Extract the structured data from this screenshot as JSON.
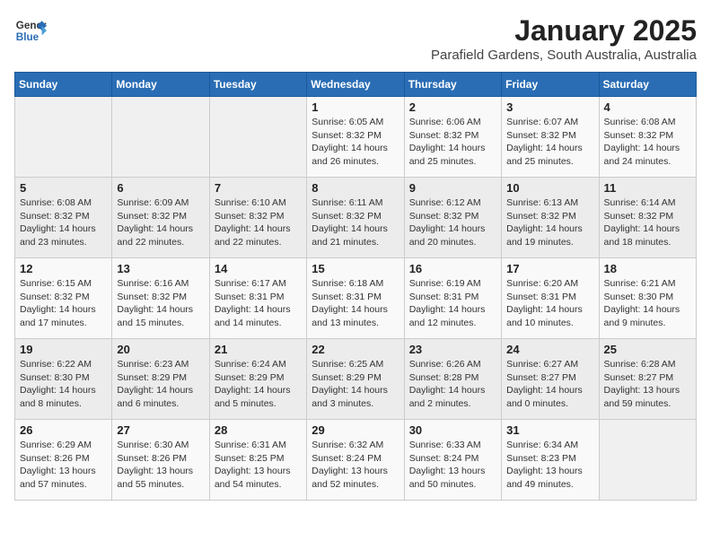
{
  "header": {
    "logo_general": "General",
    "logo_blue": "Blue",
    "month_title": "January 2025",
    "location": "Parafield Gardens, South Australia, Australia"
  },
  "weekdays": [
    "Sunday",
    "Monday",
    "Tuesday",
    "Wednesday",
    "Thursday",
    "Friday",
    "Saturday"
  ],
  "weeks": [
    [
      {
        "day": "",
        "sunrise": "",
        "sunset": "",
        "daylight": ""
      },
      {
        "day": "",
        "sunrise": "",
        "sunset": "",
        "daylight": ""
      },
      {
        "day": "",
        "sunrise": "",
        "sunset": "",
        "daylight": ""
      },
      {
        "day": "1",
        "sunrise": "Sunrise: 6:05 AM",
        "sunset": "Sunset: 8:32 PM",
        "daylight": "Daylight: 14 hours and 26 minutes."
      },
      {
        "day": "2",
        "sunrise": "Sunrise: 6:06 AM",
        "sunset": "Sunset: 8:32 PM",
        "daylight": "Daylight: 14 hours and 25 minutes."
      },
      {
        "day": "3",
        "sunrise": "Sunrise: 6:07 AM",
        "sunset": "Sunset: 8:32 PM",
        "daylight": "Daylight: 14 hours and 25 minutes."
      },
      {
        "day": "4",
        "sunrise": "Sunrise: 6:08 AM",
        "sunset": "Sunset: 8:32 PM",
        "daylight": "Daylight: 14 hours and 24 minutes."
      }
    ],
    [
      {
        "day": "5",
        "sunrise": "Sunrise: 6:08 AM",
        "sunset": "Sunset: 8:32 PM",
        "daylight": "Daylight: 14 hours and 23 minutes."
      },
      {
        "day": "6",
        "sunrise": "Sunrise: 6:09 AM",
        "sunset": "Sunset: 8:32 PM",
        "daylight": "Daylight: 14 hours and 22 minutes."
      },
      {
        "day": "7",
        "sunrise": "Sunrise: 6:10 AM",
        "sunset": "Sunset: 8:32 PM",
        "daylight": "Daylight: 14 hours and 22 minutes."
      },
      {
        "day": "8",
        "sunrise": "Sunrise: 6:11 AM",
        "sunset": "Sunset: 8:32 PM",
        "daylight": "Daylight: 14 hours and 21 minutes."
      },
      {
        "day": "9",
        "sunrise": "Sunrise: 6:12 AM",
        "sunset": "Sunset: 8:32 PM",
        "daylight": "Daylight: 14 hours and 20 minutes."
      },
      {
        "day": "10",
        "sunrise": "Sunrise: 6:13 AM",
        "sunset": "Sunset: 8:32 PM",
        "daylight": "Daylight: 14 hours and 19 minutes."
      },
      {
        "day": "11",
        "sunrise": "Sunrise: 6:14 AM",
        "sunset": "Sunset: 8:32 PM",
        "daylight": "Daylight: 14 hours and 18 minutes."
      }
    ],
    [
      {
        "day": "12",
        "sunrise": "Sunrise: 6:15 AM",
        "sunset": "Sunset: 8:32 PM",
        "daylight": "Daylight: 14 hours and 17 minutes."
      },
      {
        "day": "13",
        "sunrise": "Sunrise: 6:16 AM",
        "sunset": "Sunset: 8:32 PM",
        "daylight": "Daylight: 14 hours and 15 minutes."
      },
      {
        "day": "14",
        "sunrise": "Sunrise: 6:17 AM",
        "sunset": "Sunset: 8:31 PM",
        "daylight": "Daylight: 14 hours and 14 minutes."
      },
      {
        "day": "15",
        "sunrise": "Sunrise: 6:18 AM",
        "sunset": "Sunset: 8:31 PM",
        "daylight": "Daylight: 14 hours and 13 minutes."
      },
      {
        "day": "16",
        "sunrise": "Sunrise: 6:19 AM",
        "sunset": "Sunset: 8:31 PM",
        "daylight": "Daylight: 14 hours and 12 minutes."
      },
      {
        "day": "17",
        "sunrise": "Sunrise: 6:20 AM",
        "sunset": "Sunset: 8:31 PM",
        "daylight": "Daylight: 14 hours and 10 minutes."
      },
      {
        "day": "18",
        "sunrise": "Sunrise: 6:21 AM",
        "sunset": "Sunset: 8:30 PM",
        "daylight": "Daylight: 14 hours and 9 minutes."
      }
    ],
    [
      {
        "day": "19",
        "sunrise": "Sunrise: 6:22 AM",
        "sunset": "Sunset: 8:30 PM",
        "daylight": "Daylight: 14 hours and 8 minutes."
      },
      {
        "day": "20",
        "sunrise": "Sunrise: 6:23 AM",
        "sunset": "Sunset: 8:29 PM",
        "daylight": "Daylight: 14 hours and 6 minutes."
      },
      {
        "day": "21",
        "sunrise": "Sunrise: 6:24 AM",
        "sunset": "Sunset: 8:29 PM",
        "daylight": "Daylight: 14 hours and 5 minutes."
      },
      {
        "day": "22",
        "sunrise": "Sunrise: 6:25 AM",
        "sunset": "Sunset: 8:29 PM",
        "daylight": "Daylight: 14 hours and 3 minutes."
      },
      {
        "day": "23",
        "sunrise": "Sunrise: 6:26 AM",
        "sunset": "Sunset: 8:28 PM",
        "daylight": "Daylight: 14 hours and 2 minutes."
      },
      {
        "day": "24",
        "sunrise": "Sunrise: 6:27 AM",
        "sunset": "Sunset: 8:27 PM",
        "daylight": "Daylight: 14 hours and 0 minutes."
      },
      {
        "day": "25",
        "sunrise": "Sunrise: 6:28 AM",
        "sunset": "Sunset: 8:27 PM",
        "daylight": "Daylight: 13 hours and 59 minutes."
      }
    ],
    [
      {
        "day": "26",
        "sunrise": "Sunrise: 6:29 AM",
        "sunset": "Sunset: 8:26 PM",
        "daylight": "Daylight: 13 hours and 57 minutes."
      },
      {
        "day": "27",
        "sunrise": "Sunrise: 6:30 AM",
        "sunset": "Sunset: 8:26 PM",
        "daylight": "Daylight: 13 hours and 55 minutes."
      },
      {
        "day": "28",
        "sunrise": "Sunrise: 6:31 AM",
        "sunset": "Sunset: 8:25 PM",
        "daylight": "Daylight: 13 hours and 54 minutes."
      },
      {
        "day": "29",
        "sunrise": "Sunrise: 6:32 AM",
        "sunset": "Sunset: 8:24 PM",
        "daylight": "Daylight: 13 hours and 52 minutes."
      },
      {
        "day": "30",
        "sunrise": "Sunrise: 6:33 AM",
        "sunset": "Sunset: 8:24 PM",
        "daylight": "Daylight: 13 hours and 50 minutes."
      },
      {
        "day": "31",
        "sunrise": "Sunrise: 6:34 AM",
        "sunset": "Sunset: 8:23 PM",
        "daylight": "Daylight: 13 hours and 49 minutes."
      },
      {
        "day": "",
        "sunrise": "",
        "sunset": "",
        "daylight": ""
      }
    ]
  ]
}
